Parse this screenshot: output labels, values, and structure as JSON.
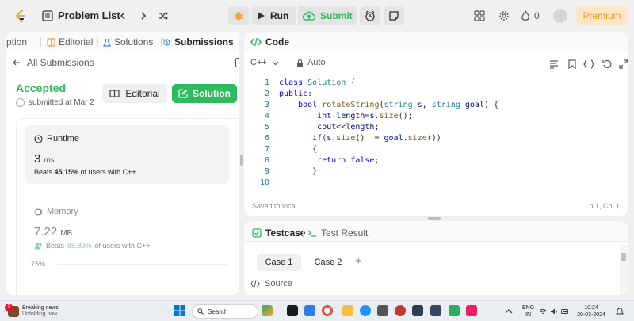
{
  "topbar": {
    "problem_list": "Problem List",
    "run": "Run",
    "submit": "Submit",
    "fire_count": "0",
    "premium": "Premium"
  },
  "left": {
    "tabs": [
      "ption",
      "Editorial",
      "Solutions",
      "Submissions"
    ],
    "all_submissions": "All Submissions",
    "status": "Accepted",
    "submitted": "submitted at Mar 2",
    "editorial_btn": "Editorial",
    "solution_btn": "Solution",
    "runtime": {
      "title": "Runtime",
      "value": "3",
      "unit": "ms",
      "beats_prefix": "Beats",
      "beats_pct": "45.15%",
      "beats_suffix": "of users with C++"
    },
    "memory": {
      "title": "Memory",
      "value": "7.22",
      "unit": "MB",
      "beats_prefix": "Beats",
      "beats_pct": "85.89%",
      "beats_suffix": "of users with C++"
    },
    "chart_tick": "75%"
  },
  "code": {
    "title": "Code",
    "language": "C++",
    "autocomplete": "Auto",
    "saved": "Saved to local",
    "position": "Ln 1, Col 1"
  },
  "testcase": {
    "tab": "Testcase",
    "result_tab": "Test Result",
    "case1": "Case 1",
    "case2": "Case 2",
    "add": "+",
    "source": "Source"
  },
  "taskbar": {
    "news_badge": "1",
    "news_title": "Breaking news",
    "news_sub": "Unfolding now",
    "search": "Search",
    "lang1": "ENG",
    "lang2": "IN",
    "time": "10:24",
    "date": "20-03-2024"
  },
  "colors": {
    "accent_green": "#2cbb5d",
    "premium_orange": "#e89b2d"
  }
}
